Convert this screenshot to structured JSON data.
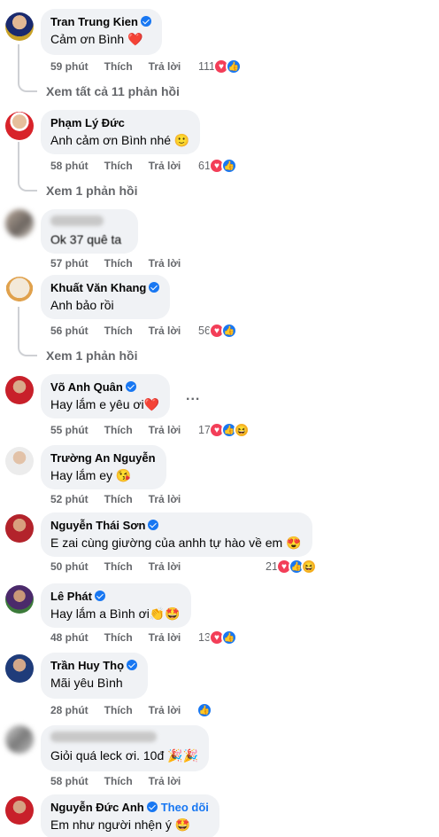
{
  "comments": [
    {
      "name": "Tran Trung Kien",
      "verified": true,
      "text": "Cảm ơn Bình ❤️",
      "time": "59 phút",
      "like": "Thích",
      "reply": "Trả lời",
      "count": "111",
      "reactions": [
        "love",
        "like"
      ],
      "replies_link": "Xem tất cả 11 phản hồi"
    },
    {
      "name": "Phạm Lý Đức",
      "verified": false,
      "text": "Anh cảm ơn Bình nhé 🙂",
      "time": "58 phút",
      "like": "Thích",
      "reply": "Trả lời",
      "count": "61",
      "reactions": [
        "love",
        "like"
      ],
      "replies_link": "Xem 1 phản hồi"
    },
    {
      "name": "",
      "verified": false,
      "text": "Ok 37 quê ta",
      "time": "57 phút",
      "like": "Thích",
      "reply": "Trả lời",
      "count": "",
      "reactions": []
    },
    {
      "name": "Khuất Văn Khang",
      "verified": true,
      "text": "Anh bảo rồi",
      "time": "56 phút",
      "like": "Thích",
      "reply": "Trả lời",
      "count": "56",
      "reactions": [
        "love",
        "like"
      ],
      "replies_link": "Xem 1 phản hồi"
    },
    {
      "name": "Võ Anh Quân",
      "verified": true,
      "text": "Hay lắm e yêu ơi❤️",
      "time": "55 phút",
      "like": "Thích",
      "reply": "Trả lời",
      "count": "17",
      "reactions": [
        "love",
        "like",
        "haha"
      ],
      "more": "..."
    },
    {
      "name": "Trường An Nguyễn",
      "verified": false,
      "text": "Hay lắm ey 😘",
      "time": "52 phút",
      "like": "Thích",
      "reply": "Trả lời",
      "count": "",
      "reactions": []
    },
    {
      "name": "Nguyễn Thái Sơn",
      "verified": true,
      "text": "E zai cùng giường của anhh tự hào về em 😍",
      "time": "50 phút",
      "like": "Thích",
      "reply": "Trả lời",
      "count": "21",
      "reactions": [
        "love",
        "like",
        "haha"
      ]
    },
    {
      "name": "Lê Phát",
      "verified": true,
      "text": "Hay lắm a Bình ơi👏🤩",
      "time": "48 phút",
      "like": "Thích",
      "reply": "Trả lời",
      "count": "13",
      "reactions": [
        "love",
        "like"
      ]
    },
    {
      "name": "Trần Huy Thọ",
      "verified": true,
      "text": "Mãi yêu Bình",
      "time": "28 phút",
      "like": "Thích",
      "reply": "Trả lời",
      "count": "",
      "reactions": [
        "like"
      ]
    },
    {
      "name": "",
      "verified": false,
      "text": "Giỏi quá leck ơi. 10đ 🎉🎉",
      "time": "58 phút",
      "like": "Thích",
      "reply": "Trả lời",
      "count": "",
      "reactions": []
    },
    {
      "name": "Nguyễn Đức Anh",
      "verified": true,
      "follow": "Theo dõi",
      "text": "Em như người nhện ý 🤩",
      "time": "",
      "like": "",
      "reply": "",
      "count": "",
      "reactions": []
    }
  ],
  "colors": {
    "like": "#1877f2",
    "love": "#f33e58",
    "haha": "#f7b125",
    "meta": "#65676b",
    "bubble": "#f0f2f5"
  }
}
